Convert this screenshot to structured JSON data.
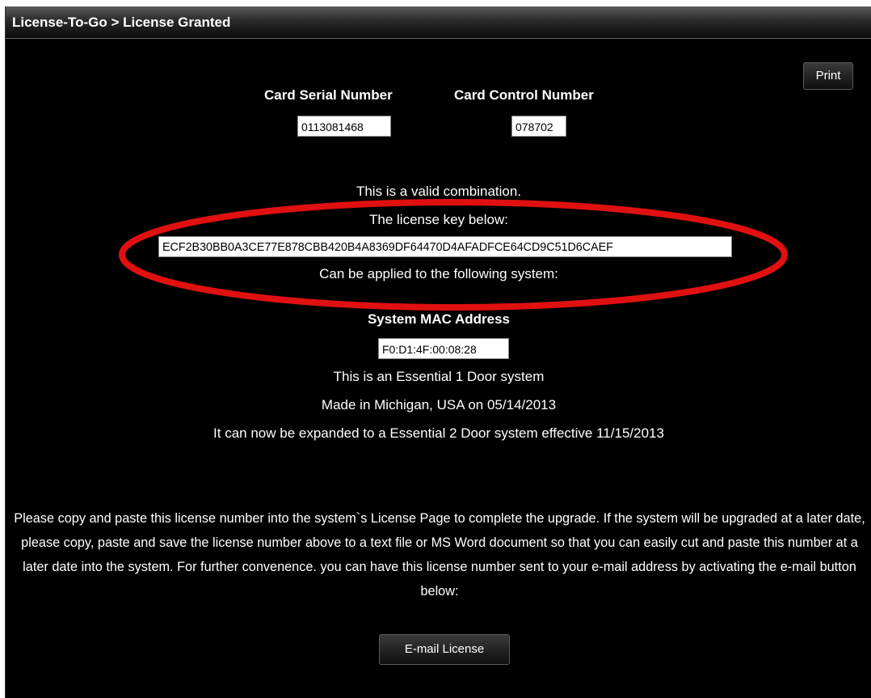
{
  "header": {
    "title": "License-To-Go > License Granted"
  },
  "toolbar": {
    "print_label": "Print"
  },
  "card": {
    "serial_label": "Card Serial Number",
    "serial_value": "0113081468",
    "control_label": "Card Control Number",
    "control_value": "078702"
  },
  "result": {
    "valid_text": "This is a valid combination.",
    "key_intro": "The license key below:",
    "license_key": "ECF2B30BB0A3CE77E878CBB420B4A8369DF64470D4AFADFCE64CD9C51D6CAEF",
    "applied_text": "Can be applied to the following system:"
  },
  "system": {
    "mac_label": "System MAC Address",
    "mac_value": "F0:D1:4F:00:08:28",
    "type_text": "This is an Essential 1 Door system",
    "made_text": "Made in Michigan, USA on 05/14/2013",
    "expand_text": "It can now be expanded to a Essential 2 Door system effective 11/15/2013"
  },
  "instructions": {
    "paragraph": "Please copy and paste this license number into the system`s License Page to complete the upgrade. If the system will be upgraded at a later date, please copy, paste and save the license number above to a text file or MS Word document so that you can easily cut and paste this number at a later date into the system. For further convenence. you can have this license number sent to your e-mail address by activating the e-mail button below:"
  },
  "actions": {
    "email_label": "E-mail License"
  },
  "colors": {
    "highlight": "#e01010"
  }
}
